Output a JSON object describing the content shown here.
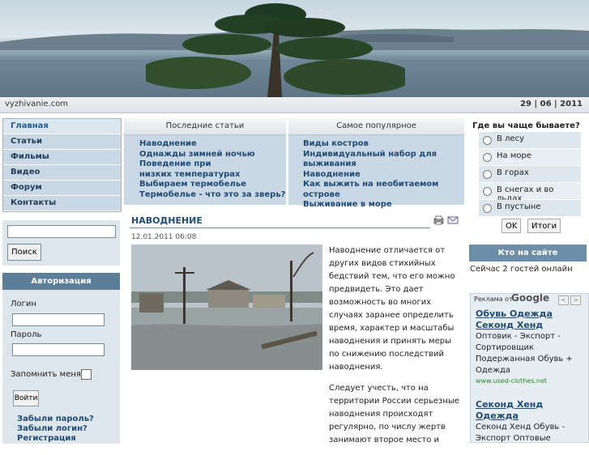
{
  "header": {
    "site_name": "vyzhivanie.com",
    "date": "29 | 06 | 2011"
  },
  "nav": [
    {
      "label": "Главная",
      "active": true
    },
    {
      "label": "Статьи"
    },
    {
      "label": "Фильмы"
    },
    {
      "label": "Видео"
    },
    {
      "label": "Форум"
    },
    {
      "label": "Контакты"
    }
  ],
  "search": {
    "button": "Поиск"
  },
  "auth": {
    "title": "Авторизация",
    "login_label": "Логин",
    "password_label": "Пароль",
    "remember_label": "Запомнить меня",
    "submit": "Войти",
    "forgot_password": "Забыли пароль?",
    "forgot_login": "Забыли логин?",
    "register": "Регистрация"
  },
  "latest": {
    "title": "Последние статьи",
    "items": [
      "Наводнение",
      "Однажды зимней ночью",
      "Поведение при низких температурах",
      "Выбираем термобелье",
      "Термобелье - что это за зверь?"
    ]
  },
  "popular": {
    "title": "Самое популярное",
    "items": [
      "Виды костров",
      "Индивидуальный набор для выживания",
      "Наводнение",
      "Как выжить на необитаемом острове",
      "Выживание в море"
    ]
  },
  "article": {
    "title": "НАВОДНЕНИЕ",
    "date": "12.01.2011 06:08",
    "p1": "Наводнение отличается от других видов стихийных бедствий тем, что его можно предвидеть. Это дает возможность во многих случаях заранее определить время, характер и масштабы наводнения и принять меры по снижению последствий наводнения.",
    "p2": "Следует учесть, что на территории России серьезные наводнения происходят регулярно, по числу жертв занимают второе место и"
  },
  "poll": {
    "question": "Где вы чаще бываете?",
    "options": [
      "В лесу",
      "На море",
      "В горах",
      "В снегах и во льдах",
      "В пустыне"
    ],
    "ok": "OK",
    "results": "Итоги"
  },
  "who_online": {
    "title": "Кто на сайте",
    "text": "Сейчас 2 гостей онлайн"
  },
  "ads": {
    "label": "Реклама от",
    "google": "Google",
    "items": [
      {
        "title": "Обувь Одежда Секонд Хенд",
        "body": "Оптовик - Экспорт - Сортировщик Подержанная Обувь + Одежда",
        "url": "www.used-clothes.net"
      },
      {
        "title": "Секонд Хенд Одежда",
        "body": "Секонд Хенд Обувь - Экспорт Оптовые поставки во всему миру"
      }
    ]
  },
  "colors": {
    "accent": "#1f4b78",
    "panel": "#c9d8e4",
    "header_dark": "#5c7e99"
  }
}
